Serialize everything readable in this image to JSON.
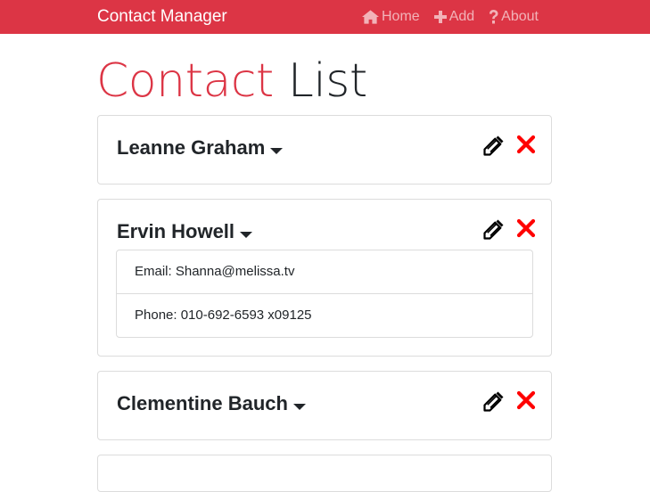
{
  "navbar": {
    "brand": "Contact Manager",
    "links": [
      {
        "label": "Home",
        "icon": "home-icon"
      },
      {
        "label": "Add",
        "icon": "plus-icon"
      },
      {
        "label": "About",
        "icon": "question-icon"
      }
    ]
  },
  "page_title": {
    "accent": "Contact",
    "rest": "List"
  },
  "contacts": [
    {
      "name": "Leanne Graham",
      "expanded": false
    },
    {
      "name": "Ervin Howell",
      "expanded": true,
      "email_label": "Email: Shanna@melissa.tv",
      "phone_label": "Phone: 010-692-6593 x09125"
    },
    {
      "name": "Clementine Bauch",
      "expanded": false
    }
  ],
  "icons": {
    "edit": "pencil-icon",
    "delete": "times-icon"
  },
  "colors": {
    "brand": "#dc3545",
    "delete": "#ff0000",
    "text": "#212529"
  }
}
